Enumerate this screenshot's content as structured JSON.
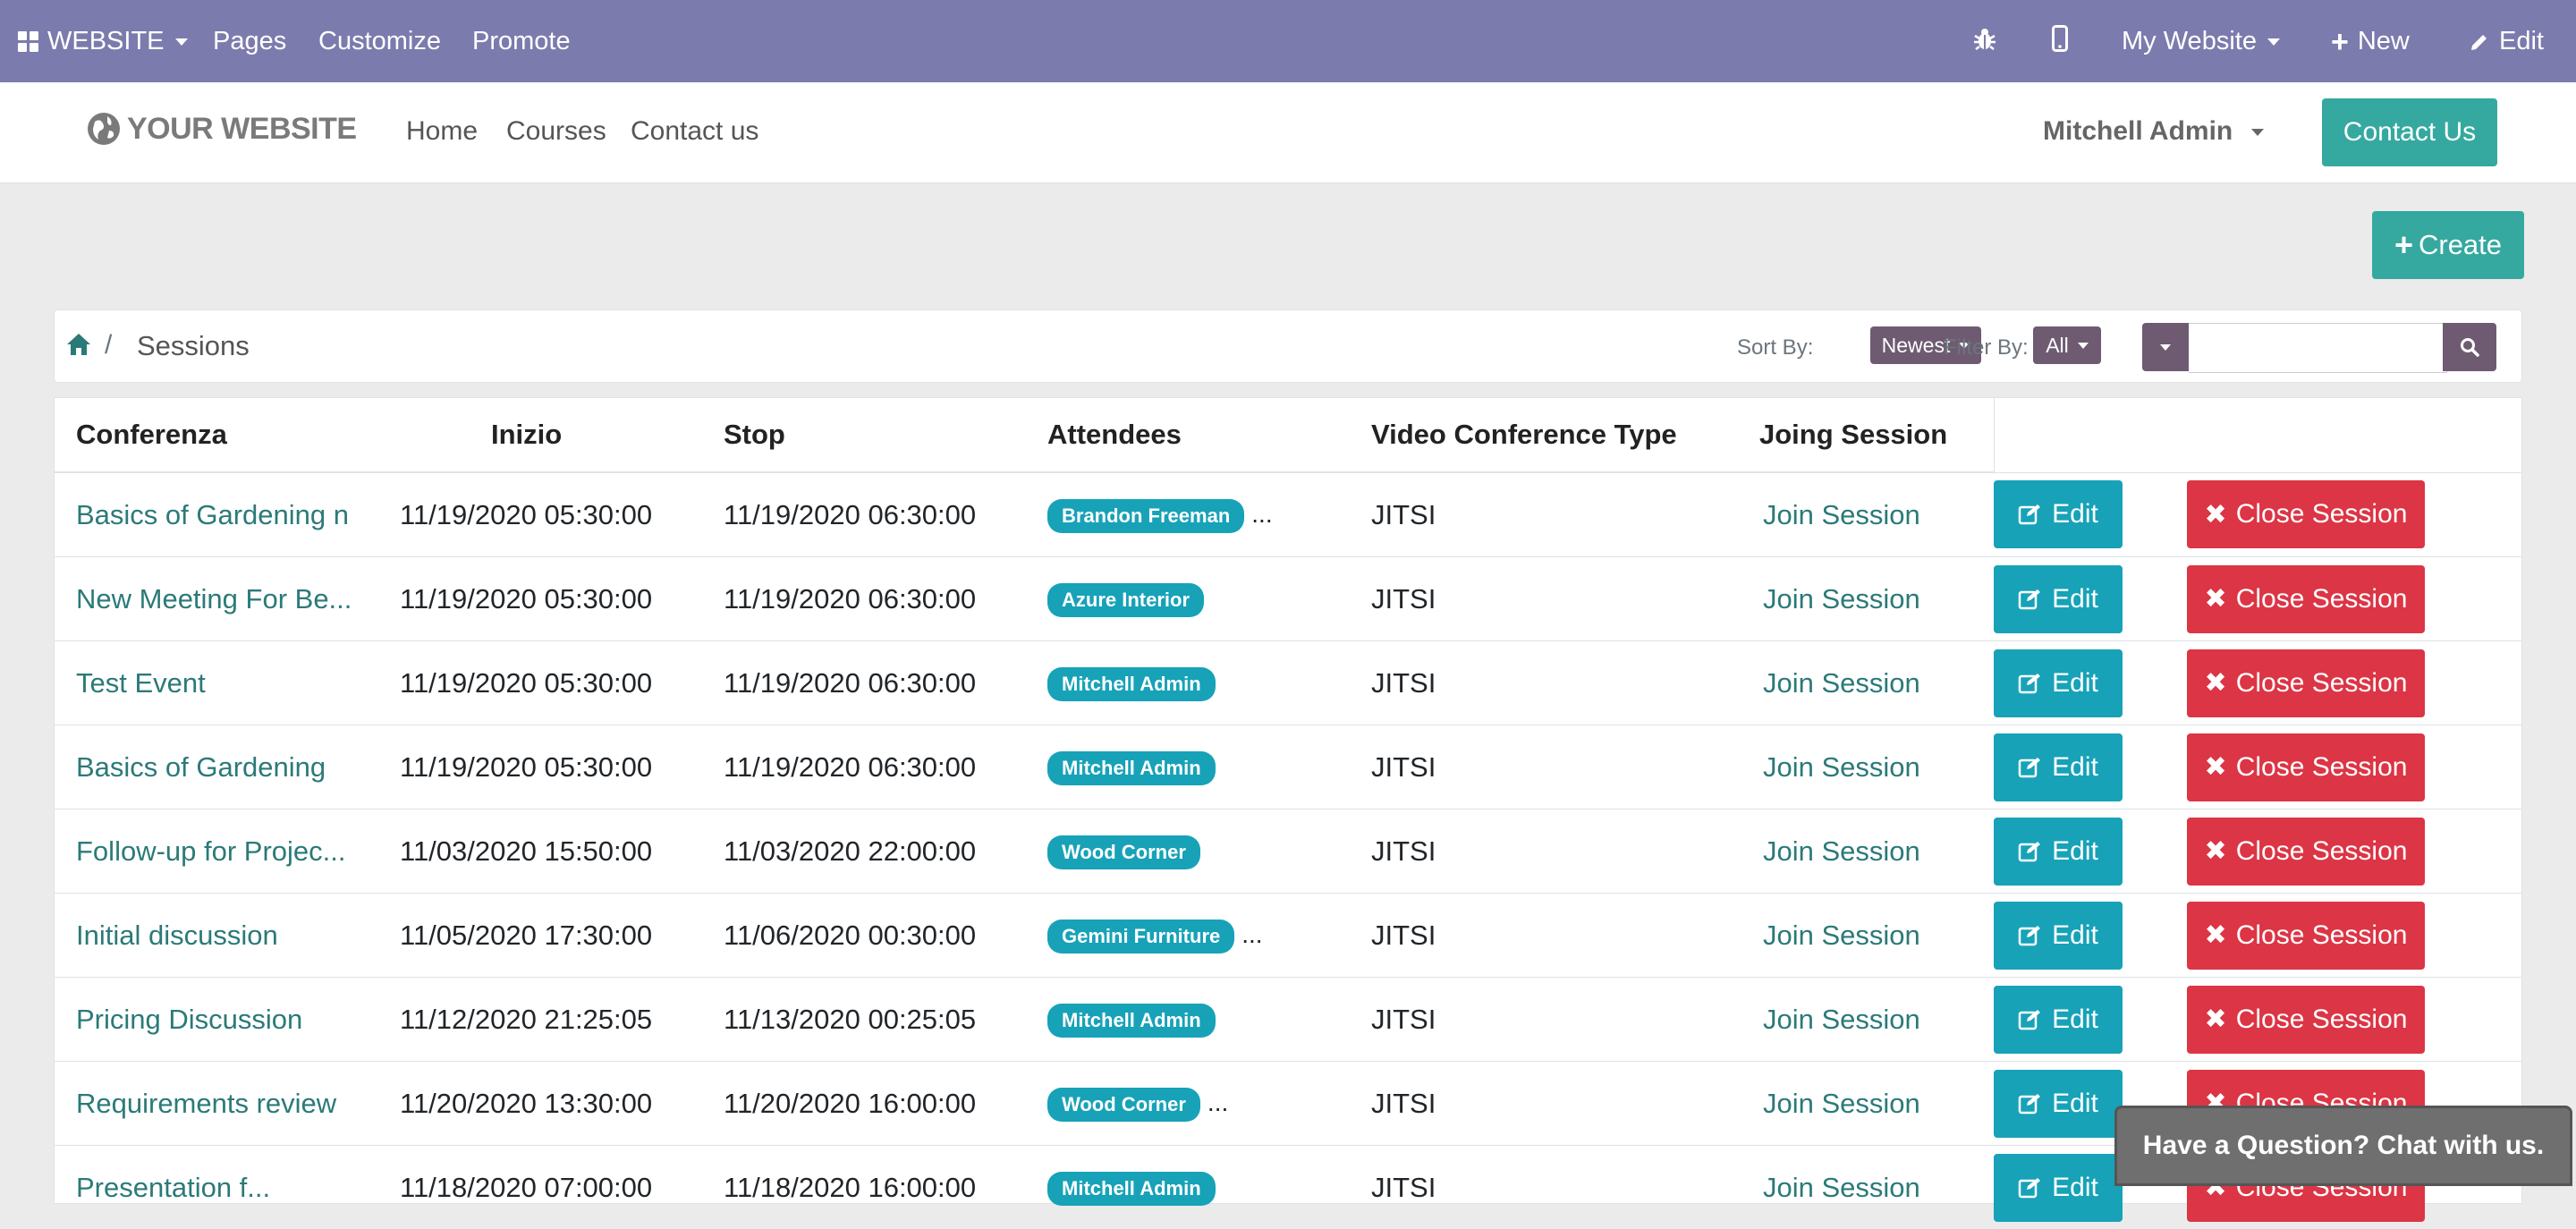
{
  "adminbar": {
    "website_label": "WEBSITE",
    "menu": [
      "Pages",
      "Customize",
      "Promote"
    ],
    "my_website": "My Website",
    "new_label": "New",
    "edit_label": "Edit"
  },
  "header": {
    "logo_text": "YOUR WEBSITE",
    "nav": [
      "Home",
      "Courses",
      "Contact us"
    ],
    "user": "Mitchell Admin",
    "contact_button": "Contact Us"
  },
  "create_button": "Create",
  "breadcrumb": {
    "current": "Sessions",
    "separator": "/"
  },
  "controls": {
    "sort_label": "Sort By:",
    "sort_value": "Newest",
    "filter_label": "Filter By:",
    "filter_value": "All",
    "search_value": ""
  },
  "table": {
    "headers": [
      "Conferenza",
      "Inizio",
      "Stop",
      "Attendees",
      "Video Conference Type",
      "Joing Session",
      "",
      ""
    ],
    "rows": [
      {
        "name": "Basics of Gardening n",
        "start": "11/19/2020 05:30:00",
        "stop": "11/19/2020 06:30:00",
        "attendee": "Brandon Freeman",
        "more": "...",
        "type": "JITSI",
        "join": "Join Session",
        "edit": "Edit",
        "close": "Close Session"
      },
      {
        "name": "New Meeting For Be...",
        "start": "11/19/2020 05:30:00",
        "stop": "11/19/2020 06:30:00",
        "attendee": "Azure Interior",
        "more": "",
        "type": "JITSI",
        "join": "Join Session",
        "edit": "Edit",
        "close": "Close Session"
      },
      {
        "name": "Test Event",
        "start": "11/19/2020 05:30:00",
        "stop": "11/19/2020 06:30:00",
        "attendee": "Mitchell Admin",
        "more": "",
        "type": "JITSI",
        "join": "Join Session",
        "edit": "Edit",
        "close": "Close Session"
      },
      {
        "name": "Basics of Gardening",
        "start": "11/19/2020 05:30:00",
        "stop": "11/19/2020 06:30:00",
        "attendee": "Mitchell Admin",
        "more": "",
        "type": "JITSI",
        "join": "Join Session",
        "edit": "Edit",
        "close": "Close Session"
      },
      {
        "name": "Follow-up for Projec...",
        "start": "11/03/2020 15:50:00",
        "stop": "11/03/2020 22:00:00",
        "attendee": "Wood Corner",
        "more": "",
        "type": "JITSI",
        "join": "Join Session",
        "edit": "Edit",
        "close": "Close Session"
      },
      {
        "name": "Initial discussion",
        "start": "11/05/2020 17:30:00",
        "stop": "11/06/2020 00:30:00",
        "attendee": "Gemini Furniture",
        "more": "...",
        "type": "JITSI",
        "join": "Join Session",
        "edit": "Edit",
        "close": "Close Session"
      },
      {
        "name": "Pricing Discussion",
        "start": "11/12/2020 21:25:05",
        "stop": "11/13/2020 00:25:05",
        "attendee": "Mitchell Admin",
        "more": "",
        "type": "JITSI",
        "join": "Join Session",
        "edit": "Edit",
        "close": "Close Session"
      },
      {
        "name": "Requirements review",
        "start": "11/20/2020 13:30:00",
        "stop": "11/20/2020 16:00:00",
        "attendee": "Wood Corner",
        "more": "...",
        "type": "JITSI",
        "join": "Join Session",
        "edit": "Edit",
        "close": "Close Session"
      },
      {
        "name": "Presentation f...",
        "start": "11/18/2020 07:00:00",
        "stop": "11/18/2020 16:00:00",
        "attendee": "Mitchell Admin",
        "more": "",
        "type": "JITSI",
        "join": "Join Session",
        "edit": "Edit",
        "close": "Close Session"
      }
    ]
  },
  "chat_label": "Have a Question? Chat with us.",
  "colors": {
    "admin_bar": "#7c7bad",
    "primary": "#35a99f",
    "info": "#17a2b8",
    "danger": "#dc3545",
    "dropdown": "#6e5b72",
    "link": "#2b7a78"
  }
}
